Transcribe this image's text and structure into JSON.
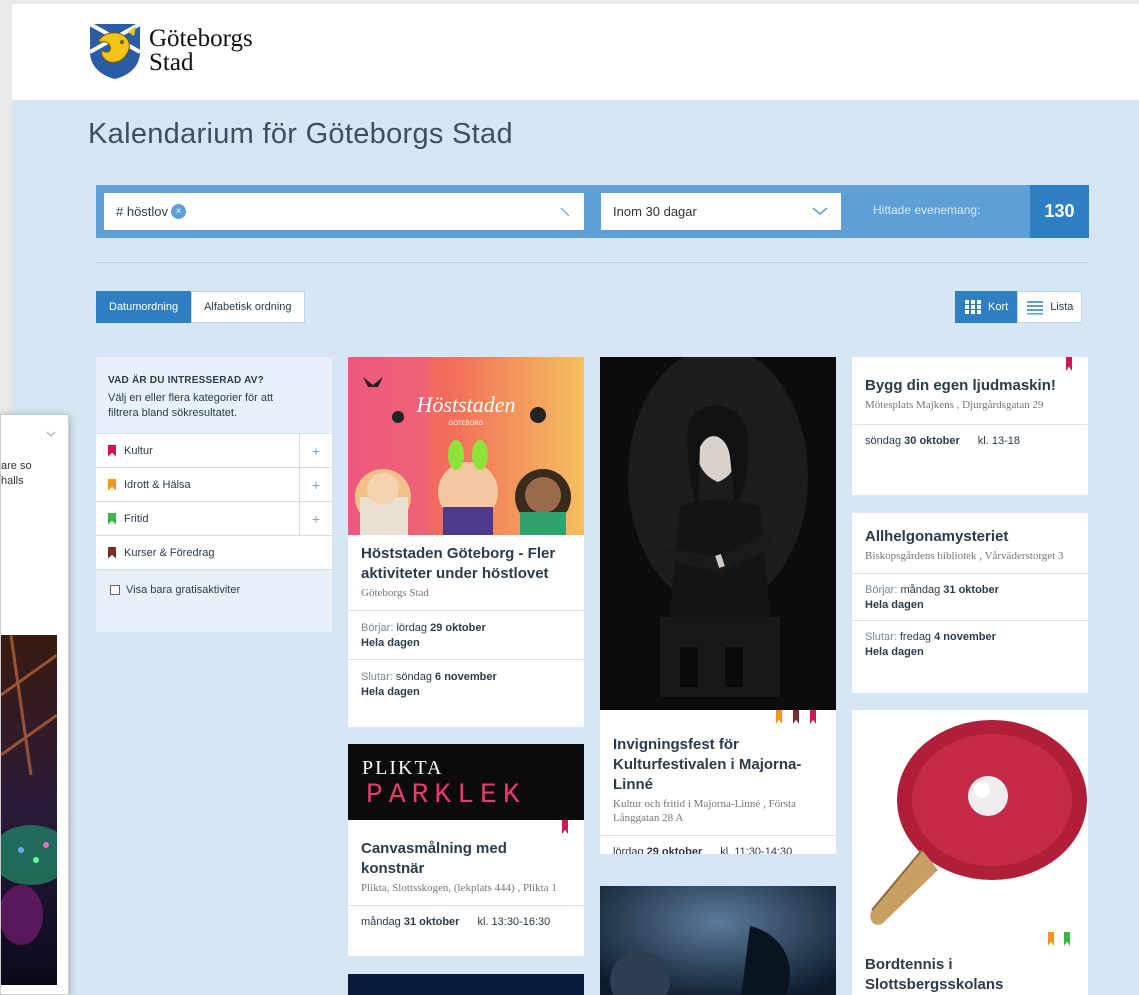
{
  "logo": {
    "line1": "Göteborgs",
    "line2": "Stad"
  },
  "page_title": "Kalendarium för Göteborgs Stad",
  "search": {
    "tag": "# höstlov",
    "tag_remove": "×"
  },
  "range": {
    "selected": "Inom 30 dagar"
  },
  "found": {
    "label": "Hittade evenemang:",
    "count": "130"
  },
  "sort": {
    "date": "Datumordning",
    "alpha": "Alfabetisk ordning"
  },
  "view": {
    "cards": "Kort",
    "list": "Lista"
  },
  "filter": {
    "heading": "VAD ÄR DU INTRESSERAD AV?",
    "description": "Välj en eller flera kategorier för att filtrera bland sökresultatet.",
    "categories": [
      {
        "label": "Kultur",
        "color": "#d4145a",
        "plus": "+"
      },
      {
        "label": "Idrott & Hälsa",
        "color": "#f7941d",
        "plus": "+"
      },
      {
        "label": "Fritid",
        "color": "#39b54a",
        "plus": "+"
      },
      {
        "label": "Kurser & Föredrag",
        "color": "#7b2d26",
        "plus": ""
      }
    ],
    "free_only": "Visa bara gratisaktiviter"
  },
  "cards": {
    "hoststaden": {
      "image_text": "Höststaden",
      "image_sub": "GÖTEBORG",
      "title": "Höststaden Göteborg - Fler aktiviteter under höstlovet",
      "location": "Göteborgs Stad",
      "start_label": "Börjar:",
      "start_date": "lördag",
      "start_date_bold": "29 oktober",
      "start_time": "Hela dagen",
      "end_label": "Slutar:",
      "end_date": "söndag",
      "end_date_bold": "6 november",
      "end_time": "Hela dagen"
    },
    "plikta": {
      "image_line1": "PLIKTA",
      "image_line2": "PARKLEK",
      "title": "Canvasmålning med konstnär",
      "location": "Plikta, Slottsskogen, (lekplats 444) , Plikta 1",
      "date": "måndag",
      "date_bold": "31 oktober",
      "time": "kl. 13:30-16:30"
    },
    "invigning": {
      "title": "Invigningsfest för Kulturfestivalen i Majorna-Linné",
      "location": "Kultur och fritid i Majorna-Linné , Första Långgatan 28 A",
      "date": "lördag",
      "date_bold": "29 oktober",
      "time": "kl. 11:30-14:30"
    },
    "ljudmaskin": {
      "title": "Bygg din egen ljudmaskin!",
      "location": "Mötesplats Majkens , Djurgårdsgatan 29",
      "date": "söndag",
      "date_bold": "30 oktober",
      "time": "kl. 13-18"
    },
    "allhelgona": {
      "title": "Allhelgonamysteriet",
      "location": "Biskopsgårdens bibliotek , Vårväderstorget 3",
      "start_label": "Börjar:",
      "start_date": "måndag",
      "start_date_bold": "31 oktober",
      "start_time": "Hela dagen",
      "end_label": "Slutar:",
      "end_date": "fredag",
      "end_date_bold": "4 november",
      "end_time": "Hela dagen"
    },
    "bordtennis": {
      "title": "Bordtennis i Slottsbergsskolans"
    }
  },
  "popup": {
    "text_line1": "are so",
    "text_line2": "halls"
  },
  "colors": {
    "accent": "#2f7fc5",
    "bar": "#5d9fd6",
    "background": "#d6e6f4",
    "kultur": "#d4145a",
    "idrott": "#f7941d",
    "fritid": "#39b54a",
    "kurser": "#7b2d26"
  }
}
